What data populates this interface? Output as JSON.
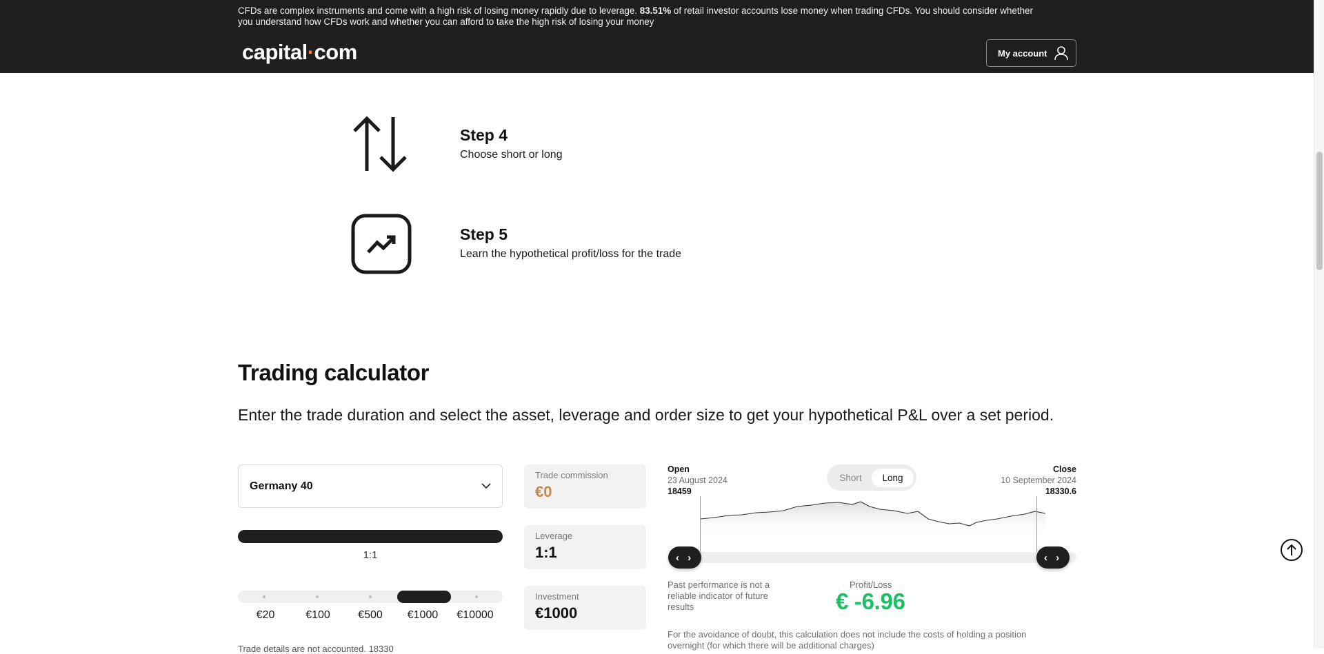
{
  "header": {
    "risk_prefix": "CFDs are complex instruments and come with a high risk of losing money rapidly due to leverage. ",
    "risk_percent": "83.51%",
    "risk_suffix": " of retail investor accounts lose money when trading CFDs. You should consider whether you understand how CFDs work and whether you can afford to take the high risk of losing your money",
    "logo_part1": "capital",
    "logo_dot": "·",
    "logo_part2": "com",
    "account_label": "My account"
  },
  "steps": [
    {
      "title": "Step 4",
      "desc": "Choose short or long",
      "icon": "arrows-up-down-icon"
    },
    {
      "title": "Step 5",
      "desc": "Learn the hypothetical profit/loss for the trade",
      "icon": "trend-up-icon"
    }
  ],
  "calculator": {
    "title": "Trading calculator",
    "description": "Enter the trade duration and select the asset, leverage and order size to get your hypothetical P&L over a set period.",
    "asset": "Germany 40",
    "leverage_label": "1:1",
    "sizes": [
      "€20",
      "€100",
      "€500",
      "€1000",
      "€10000"
    ],
    "selected_size_index": 3,
    "info": {
      "commission_label": "Trade commission",
      "commission_value": "€0",
      "leverage_label": "Leverage",
      "leverage_value": "1:1",
      "investment_label": "Investment",
      "investment_value": "€1000"
    },
    "chart": {
      "open_label": "Open",
      "open_date": "23 August 2024",
      "open_value": "18459",
      "close_label": "Close",
      "close_date": "10 September 2024",
      "close_value": "18330.6",
      "toggle_short": "Short",
      "toggle_long": "Long",
      "toggle_selected": "Long",
      "handle_glyph": "‹ ›"
    },
    "past_note": "Past performance is not a reliable indicator of future results",
    "pl_label": "Profit/Loss",
    "pl_value": "€ -6.96",
    "doubt_note": "For the avoidance of doubt, this calculation does not include the costs of holding a position overnight (for which there will be additional charges)",
    "partial_note": "Trade details are not accounted. 18330"
  },
  "colors": {
    "accent_orange": "#ff7a2e",
    "profit_green": "#1cbf63"
  },
  "chart_data": {
    "type": "line",
    "x": [
      "23 August 2024",
      "10 September 2024"
    ],
    "series": [
      {
        "values": [
          18459,
          18330.6
        ]
      }
    ]
  }
}
